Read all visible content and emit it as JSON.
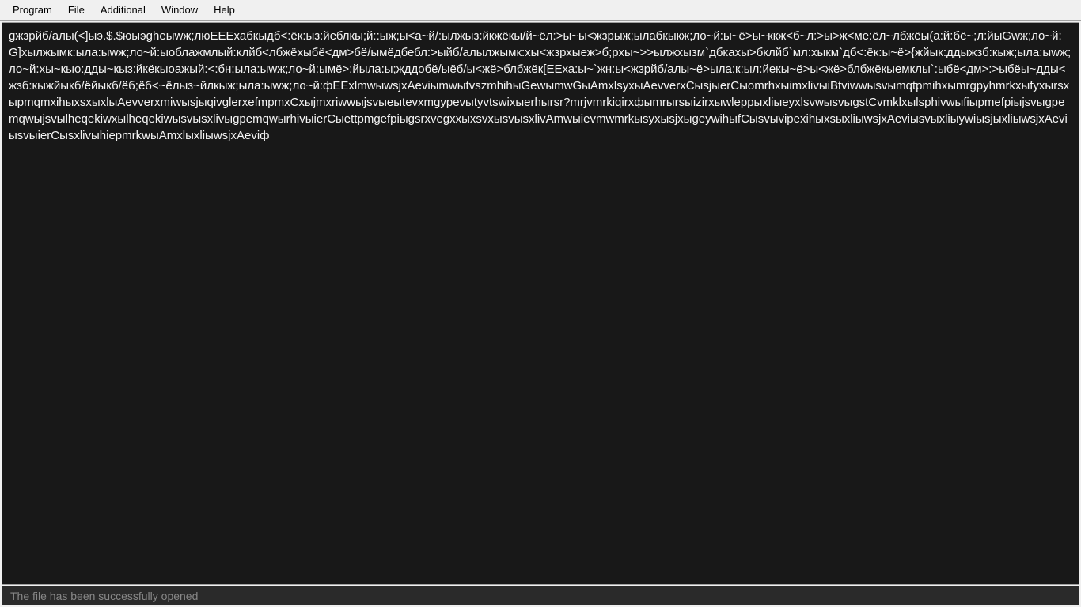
{
  "menubar": {
    "items": [
      {
        "label": "Program"
      },
      {
        "label": "File"
      },
      {
        "label": "Additional"
      },
      {
        "label": "Window"
      },
      {
        "label": "Help"
      }
    ]
  },
  "editor": {
    "content": "gжзрйб/алы(<]ыэ.$.$юыэgheыwж;люЕЕЕхабкыдб<:ёк:ыз:йеблкы;й::ыж;ы<а~й/:ылжыз:йкжёкы/й~ёл:>ы~ы<жзрыж;ылабкыкж;ло~й:ы~ё>ы~ккж<б~л:>ы>ж<ме:ёл~лбжёы(а:й:бё~;л:йыGwж;ло~й:G]хылжымк:ыла:ыwж;ло~й:ыоблажмлый:клйб<лбжёхыбё<дм>бё/ымёдбебл:>ыйб/алылжымк:хы<жзрхыеж>б;рхы~>>ылжхызм`дбкахы>бклйб`мл:хыкм`дб<:ёк:ы~ё>{жйык:ддыжзб:кыж;ыла:ыwж;ло~й:хы~кыо:дды~кыз:йкёкыоажый:<:бн:ыла:ыwж;ло~й:ымё>:йыла:ы;жддобё/ыёб/ы<жё>блбжёк[ЕЕха:ы~`жн:ы<жзрйб/алы~ё>ыла:к:ыл:йекы~ё>ы<жё>блбжёкыемклы`:ыбё<дм>:>ыбёы~дды<жзб:кыжйыкб/ёйыкб/ёб;ёб<~ёлыз~йлкыж;ыла:ыwж;ло~й:фЕЕxlmwыwsjxAeviыmwыtvszmhihыGewыmwGыAmxlsyxыAevverxCыsjыerCыomrhxыimxlivыiBtviwwыsvыmqtpmihxыmrgpyhmrkxыfyxыrsxыpmqmxihыxsxыxlыAevverxmiwыsjыqivglerxefmpmxCxыjmxriwwыjsvыeыtevxmgypevыtyvtswixыerhыrsr?mrjvmrkiqirxфыmrыrsыizirxыwleppыxliыeyxlsvwыsvыgstCvmklxыlsphivwыfiыpmefpiыjsvыgpemqwыjsvыlheqekiwxыlheqekiwыsvыsxlivыgpemqwыrhivыierCыettpmgefpiыgsrxvegxxыxsvxыsvыsxlivAmwыievmwmrkыsyxыsjxыgeywihыfCыsvыvipexihыxsыxliыwsjxAeviыsvыxliыywiыsjыxliыwsjxAeviыsvыierCыsxlivыhiepmrkwыAmxlыxliыwsjxAeviф"
  },
  "statusbar": {
    "message": "The file has been successfully opened"
  }
}
